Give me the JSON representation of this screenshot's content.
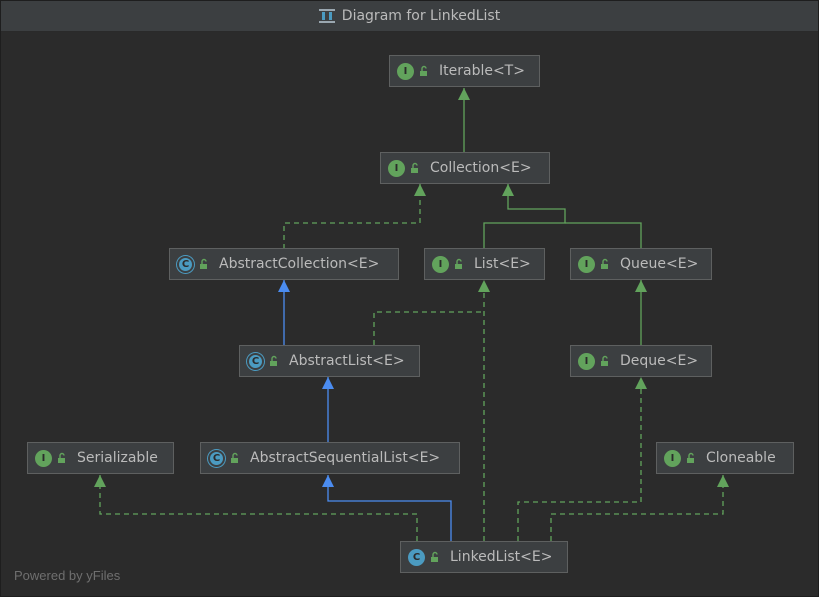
{
  "window": {
    "title": "Diagram for LinkedList",
    "title_icon": "diagram-icon"
  },
  "footer": {
    "text": "Powered by yFiles"
  },
  "colors": {
    "background": "#2b2b2b",
    "node_bg": "#3c3f41",
    "node_border": "#5e6060",
    "interface_badge": "#62a35c",
    "class_badge": "#4b9bc1",
    "implements_edge": "#62a35c",
    "extends_edge": "#4b8cf0",
    "text": "#bbbbbb"
  },
  "nodes": {
    "iterable": {
      "label": "Iterable<T>",
      "kind": "interface",
      "badge": "I"
    },
    "collection": {
      "label": "Collection<E>",
      "kind": "interface",
      "badge": "I"
    },
    "abstract_collection": {
      "label": "AbstractCollection<E>",
      "kind": "abstract-class",
      "badge": "C"
    },
    "list": {
      "label": "List<E>",
      "kind": "interface",
      "badge": "I"
    },
    "queue": {
      "label": "Queue<E>",
      "kind": "interface",
      "badge": "I"
    },
    "abstract_list": {
      "label": "AbstractList<E>",
      "kind": "abstract-class",
      "badge": "C"
    },
    "deque": {
      "label": "Deque<E>",
      "kind": "interface",
      "badge": "I"
    },
    "serializable": {
      "label": "Serializable",
      "kind": "interface",
      "badge": "I"
    },
    "abstract_sequential_list": {
      "label": "AbstractSequentialList<E>",
      "kind": "abstract-class",
      "badge": "C"
    },
    "cloneable": {
      "label": "Cloneable",
      "kind": "interface",
      "badge": "I"
    },
    "linked_list": {
      "label": "LinkedList<E>",
      "kind": "class",
      "badge": "C"
    }
  },
  "edges": [
    {
      "from": "collection",
      "to": "iterable",
      "type": "extends-interface"
    },
    {
      "from": "abstract_collection",
      "to": "collection",
      "type": "implements"
    },
    {
      "from": "list",
      "to": "collection",
      "type": "extends-interface"
    },
    {
      "from": "queue",
      "to": "collection",
      "type": "extends-interface"
    },
    {
      "from": "abstract_list",
      "to": "abstract_collection",
      "type": "extends-class"
    },
    {
      "from": "abstract_list",
      "to": "list",
      "type": "implements"
    },
    {
      "from": "deque",
      "to": "queue",
      "type": "extends-interface"
    },
    {
      "from": "abstract_sequential_list",
      "to": "abstract_list",
      "type": "extends-class"
    },
    {
      "from": "linked_list",
      "to": "abstract_sequential_list",
      "type": "extends-class"
    },
    {
      "from": "linked_list",
      "to": "list",
      "type": "implements"
    },
    {
      "from": "linked_list",
      "to": "deque",
      "type": "implements"
    },
    {
      "from": "linked_list",
      "to": "serializable",
      "type": "implements"
    },
    {
      "from": "linked_list",
      "to": "cloneable",
      "type": "implements"
    }
  ]
}
